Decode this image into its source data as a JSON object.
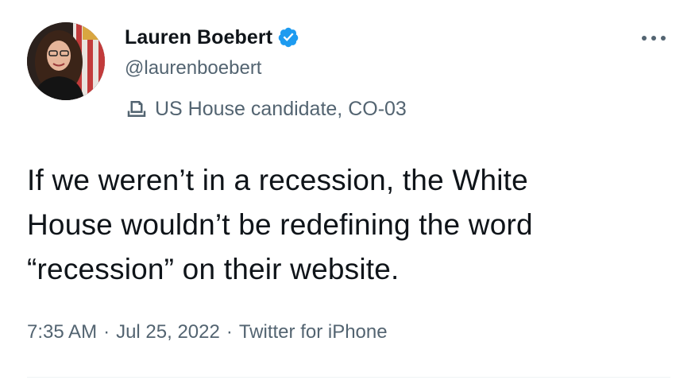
{
  "author": {
    "display_name": "Lauren Boebert",
    "handle": "@laurenboebert",
    "verified_icon": "verified-badge-icon",
    "label_icon": "ballot-box-icon",
    "label_text": "US House candidate, CO-03"
  },
  "tweet": {
    "text": "If we weren’t in a recession, the White\nHouse wouldn’t be redefining the word\n“recession” on their website.",
    "time": "7:35 AM",
    "date": "Jul 25, 2022",
    "separator": "·",
    "source": "Twitter for iPhone"
  },
  "colors": {
    "verified_blue": "#1d9bf0",
    "secondary_text": "#536471",
    "primary_text": "#0f1419"
  },
  "more_icon": "more-dots-icon"
}
